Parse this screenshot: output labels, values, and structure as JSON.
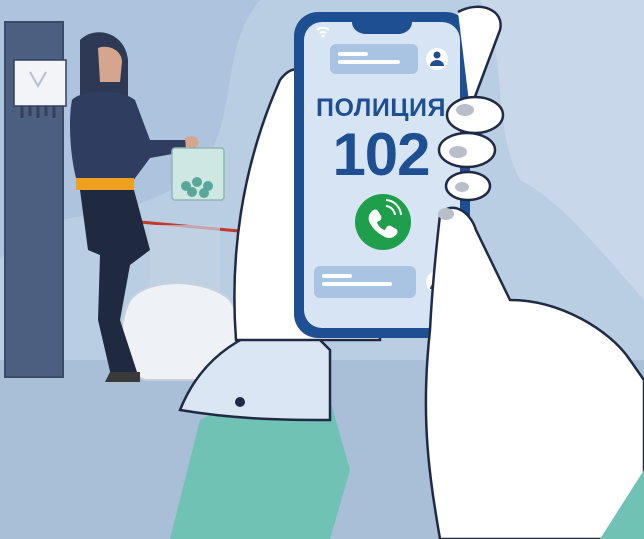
{
  "phone_screen": {
    "title": "ПОЛИЦИЯ",
    "number": "102"
  },
  "colors": {
    "background": "#b9cde3",
    "phone_frame": "#1f4f93",
    "screen": "#d6e4f3",
    "call_button": "#1f9e4b",
    "sleeve_accent": "#6fc2b4",
    "text": "#1f4f93"
  },
  "icons": [
    "wifi-icon",
    "avatar-icon",
    "phone-call-icon"
  ]
}
